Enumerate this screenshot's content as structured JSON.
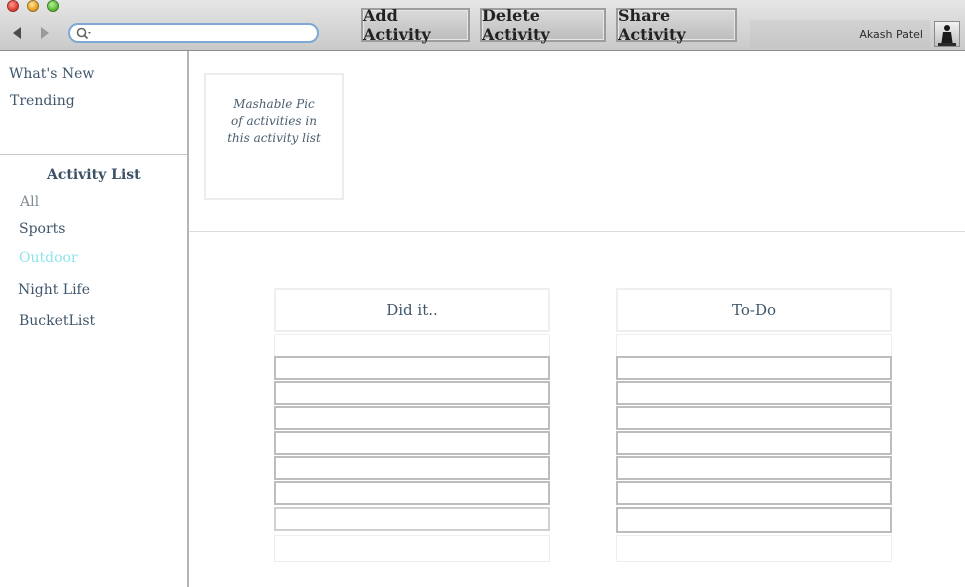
{
  "toolbar": {
    "search": {
      "placeholder": "",
      "value": ""
    },
    "buttons": {
      "add": "Add Activity",
      "delete": "Delete Activity",
      "share": "Share Activity"
    },
    "user_name": "Akash Patel"
  },
  "sidebar": {
    "links": [
      "What's New",
      "Trending"
    ],
    "activity_list_title": "Activity List",
    "items": [
      {
        "label": "All",
        "color": "#7f8c96"
      },
      {
        "label": "Sports",
        "color": "#3f566b"
      },
      {
        "label": "Outdoor",
        "color": "#8ee3ee"
      },
      {
        "label": "Night Life",
        "color": "#3f566b"
      },
      {
        "label": "BucketList",
        "color": "#3f566b"
      }
    ]
  },
  "main": {
    "pic_caption": "Mashable Pic of activities in this activity list",
    "columns": [
      {
        "title": "Did it.."
      },
      {
        "title": "To-Do"
      }
    ]
  },
  "colors": {
    "accent_selected": "#8ee3ee",
    "text": "#3f566b",
    "search_border": "#7ea9d6"
  },
  "icons": [
    "back-arrow-icon",
    "forward-arrow-icon",
    "search-icon",
    "user-silhouette-icon"
  ]
}
